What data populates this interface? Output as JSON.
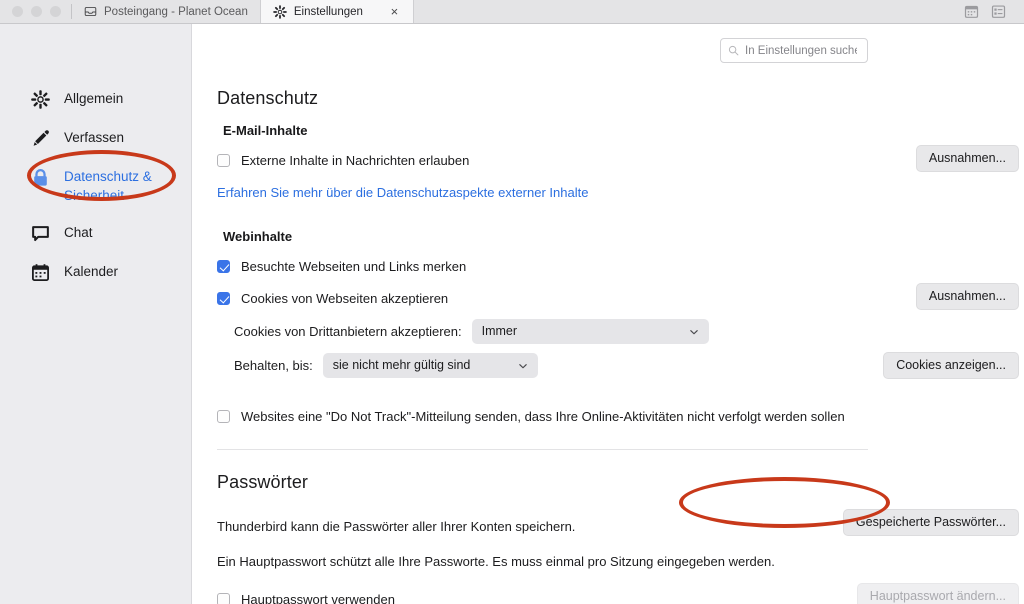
{
  "window": {
    "traffic_lights": [
      "close",
      "minimize",
      "zoom"
    ],
    "tabs": [
      {
        "label": "Posteingang - Planet Ocean",
        "icon": "inbox-icon",
        "active": false,
        "closable": false
      },
      {
        "label": "Einstellungen",
        "icon": "gear-icon",
        "active": true,
        "closable": true,
        "close_label": "×"
      }
    ],
    "toolbar_icons": [
      {
        "name": "calendar-icon"
      },
      {
        "name": "tasks-icon"
      }
    ]
  },
  "sidebar": {
    "items": [
      {
        "label": "Allgemein",
        "icon": "gear-icon",
        "selected": false
      },
      {
        "label": "Verfassen",
        "icon": "pencil-icon",
        "selected": false
      },
      {
        "label": "Datenschutz &\nSicherheit",
        "icon": "lock-icon",
        "selected": true
      },
      {
        "label": "Chat",
        "icon": "chat-bubble-icon",
        "selected": false
      },
      {
        "label": "Kalender",
        "icon": "calendar-icon",
        "selected": false
      }
    ]
  },
  "search": {
    "placeholder": "In Einstellungen suchen",
    "value": "",
    "icon": "search-icon"
  },
  "privacy": {
    "heading": "Datenschutz",
    "email_content": {
      "heading": "E-Mail-Inhalte",
      "allow_remote_label": "Externe Inhalte in Nachrichten erlauben",
      "allow_remote_checked": false,
      "exceptions_button": "Ausnahmen...",
      "learn_more_link": "Erfahren Sie mehr über die Datenschutzaspekte externer Inhalte"
    },
    "web_content": {
      "heading": "Webinhalte",
      "remember_history_label": "Besuchte Webseiten und Links merken",
      "remember_history_checked": true,
      "accept_cookies_label": "Cookies von Webseiten akzeptieren",
      "accept_cookies_checked": true,
      "cookies_exceptions_button": "Ausnahmen...",
      "third_party_label": "Cookies von Drittanbietern akzeptieren:",
      "third_party_value": "Immer",
      "keep_until_label": "Behalten, bis:",
      "keep_until_value": "sie nicht mehr gültig sind",
      "show_cookies_button": "Cookies anzeigen...",
      "dnt_label": "Websites eine \"Do Not Track\"-Mitteilung senden, dass Ihre Online-Aktivitäten nicht verfolgt werden sollen",
      "dnt_checked": false
    }
  },
  "passwords": {
    "heading": "Passwörter",
    "description": "Thunderbird kann die Passwörter aller Ihrer Konten speichern.",
    "saved_passwords_button": "Gespeicherte Passwörter...",
    "master_description": "Ein Hauptpasswort schützt alle Ihre Passworte. Es muss einmal pro Sitzung eingegeben werden.",
    "use_master_label": "Hauptpasswort verwenden",
    "use_master_checked": false,
    "change_master_button": "Hauptpasswort ändern...",
    "change_master_disabled": true
  },
  "annotations": [
    {
      "name": "highlight-sidebar-privacy",
      "color": "#c8391a"
    },
    {
      "name": "highlight-saved-passwords",
      "color": "#c8391a"
    }
  ],
  "colors": {
    "accent": "#2c6fe0",
    "checkbox_on": "#3a74e8",
    "annotation": "#c8391a",
    "sidebar_bg": "#ececef",
    "tabbar_bg": "#e4e4e6"
  }
}
